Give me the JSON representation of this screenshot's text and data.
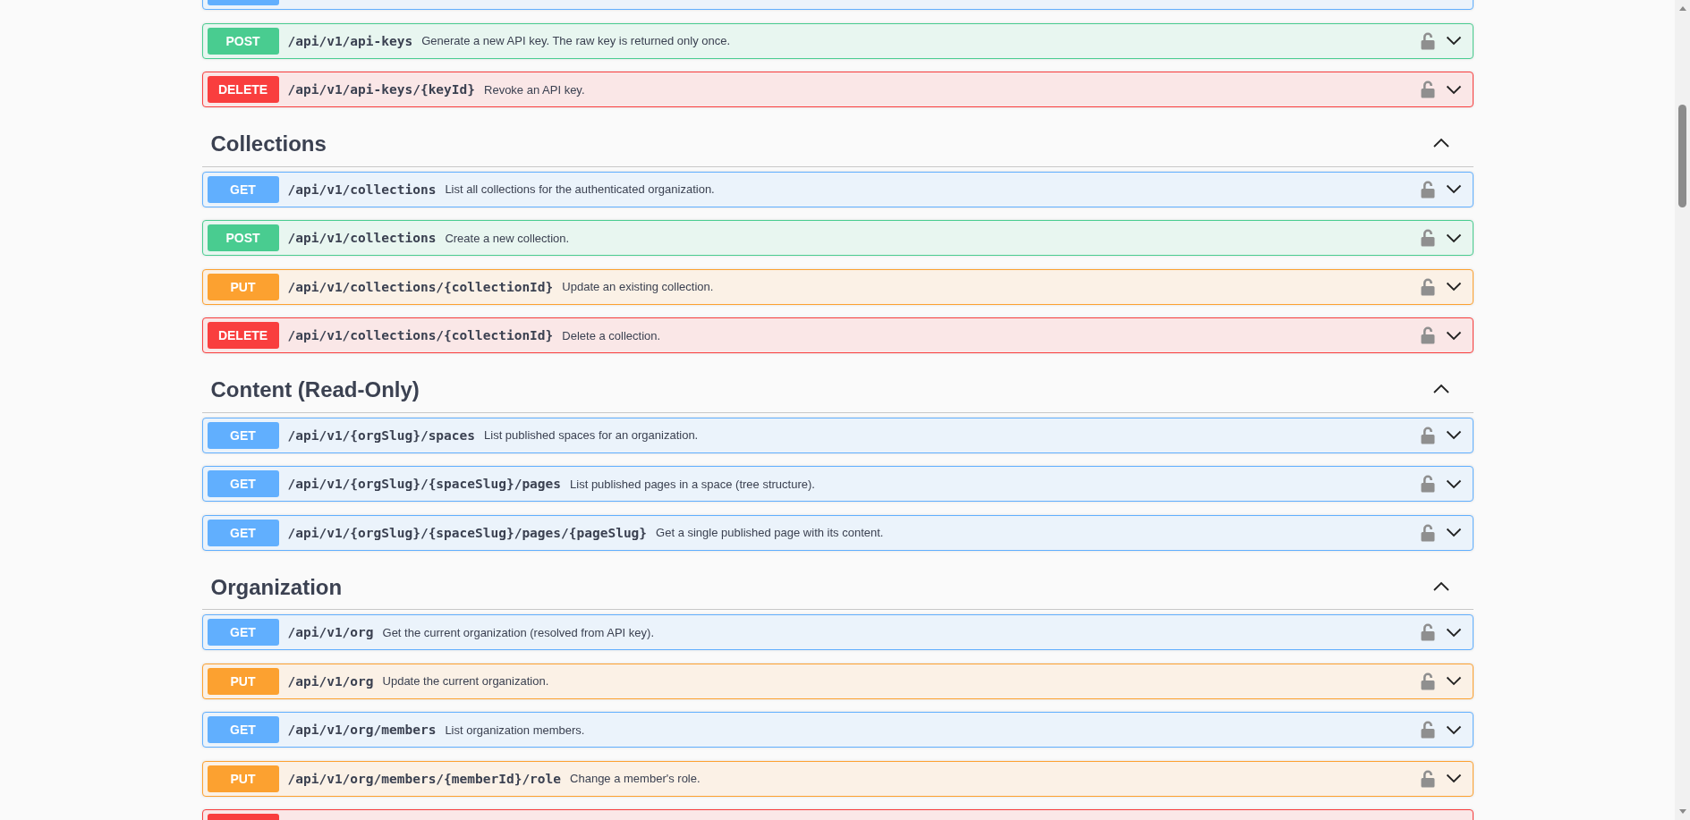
{
  "sections": [
    {
      "rows": [
        {
          "kind": "get"
        },
        {
          "kind": "post",
          "method": "POST",
          "path": "/api/v1/api-keys",
          "description": "Generate a new API key. The raw key is returned only once."
        },
        {
          "kind": "delete",
          "method": "DELETE",
          "path": "/api/v1/api-keys/{keyId}",
          "description": "Revoke an API key."
        }
      ]
    },
    {
      "title": "Collections",
      "expanded": true,
      "rows": [
        {
          "kind": "get",
          "method": "GET",
          "path": "/api/v1/collections",
          "description": "List all collections for the authenticated organization."
        },
        {
          "kind": "post",
          "method": "POST",
          "path": "/api/v1/collections",
          "description": "Create a new collection."
        },
        {
          "kind": "put",
          "method": "PUT",
          "path": "/api/v1/collections/{collectionId}",
          "description": "Update an existing collection."
        },
        {
          "kind": "delete",
          "method": "DELETE",
          "path": "/api/v1/collections/{collectionId}",
          "description": "Delete a collection."
        }
      ]
    },
    {
      "title": "Content (Read-Only)",
      "expanded": true,
      "rows": [
        {
          "kind": "get",
          "method": "GET",
          "path": "/api/v1/{orgSlug}/spaces",
          "description": "List published spaces for an organization."
        },
        {
          "kind": "get",
          "method": "GET",
          "path": "/api/v1/{orgSlug}/{spaceSlug}/pages",
          "description": "List published pages in a space (tree structure)."
        },
        {
          "kind": "get",
          "method": "GET",
          "path": "/api/v1/{orgSlug}/{spaceSlug}/pages/{pageSlug}",
          "description": "Get a single published page with its content."
        }
      ]
    },
    {
      "title": "Organization",
      "expanded": true,
      "rows": [
        {
          "kind": "get",
          "method": "GET",
          "path": "/api/v1/org",
          "description": "Get the current organization (resolved from API key)."
        },
        {
          "kind": "put",
          "method": "PUT",
          "path": "/api/v1/org",
          "description": "Update the current organization."
        },
        {
          "kind": "get",
          "method": "GET",
          "path": "/api/v1/org/members",
          "description": "List organization members."
        },
        {
          "kind": "put",
          "method": "PUT",
          "path": "/api/v1/org/members/{memberId}/role",
          "description": "Change a member's role."
        },
        {
          "kind": "delete"
        }
      ]
    }
  ]
}
